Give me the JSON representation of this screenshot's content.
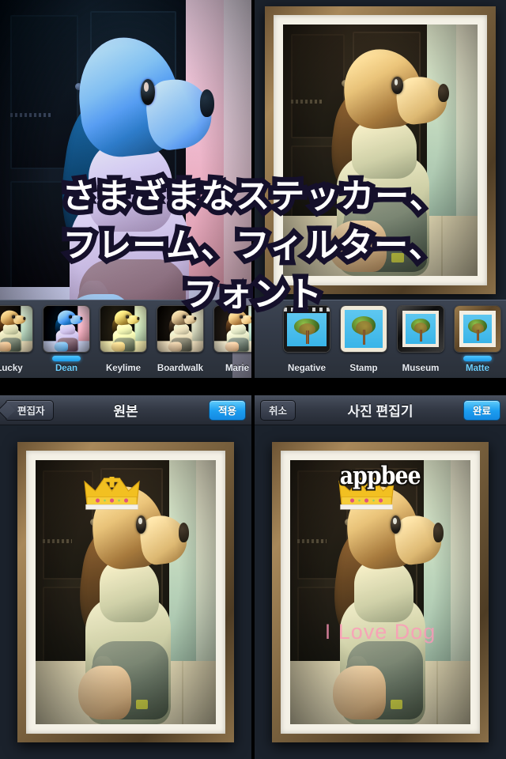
{
  "promo": {
    "lines": [
      "さまざまなステッカー、",
      "フレーム、フィルター、",
      "フォント"
    ]
  },
  "colors": {
    "accent_blue": "#1c9ef0",
    "navbar_dark": "#333945",
    "strip_bg": "#333a47",
    "promo_outline": "#15102b",
    "love_text_pink": "#ff96b9",
    "frame_gold": "#8a6c42"
  },
  "panels": {
    "top_left": {
      "name": "filter-picker-screen",
      "strip_title": "filters",
      "items": [
        {
          "label": "Lucky",
          "selected": false,
          "style": "f-lucky"
        },
        {
          "label": "Dean",
          "selected": true,
          "style": "f-dean"
        },
        {
          "label": "Keylime",
          "selected": false,
          "style": "f-keylime"
        },
        {
          "label": "Boardwalk",
          "selected": false,
          "style": "f-board"
        },
        {
          "label": "Marie",
          "selected": false,
          "style": "f-marie"
        }
      ]
    },
    "top_right": {
      "name": "frame-picker-screen",
      "items": [
        {
          "label": "Negative",
          "selected": false,
          "style": "fr-negative"
        },
        {
          "label": "Stamp",
          "selected": false,
          "style": "fr-stamp"
        },
        {
          "label": "Museum",
          "selected": false,
          "style": "fr-museum"
        },
        {
          "label": "Matte",
          "selected": true,
          "style": "fr-matte"
        }
      ]
    },
    "bottom_left": {
      "name": "original-preview-screen",
      "navbar": {
        "back_label": "편집자",
        "title": "원본",
        "primary_label": "적용"
      },
      "sticker": "crown-sticker"
    },
    "bottom_right": {
      "name": "photo-editor-screen",
      "navbar": {
        "back_label": "취소",
        "title": "사진 편집기",
        "primary_label": "완료"
      },
      "watermark": "appbee",
      "caption": "I Love Dog",
      "sticker": "crown-sticker"
    }
  }
}
